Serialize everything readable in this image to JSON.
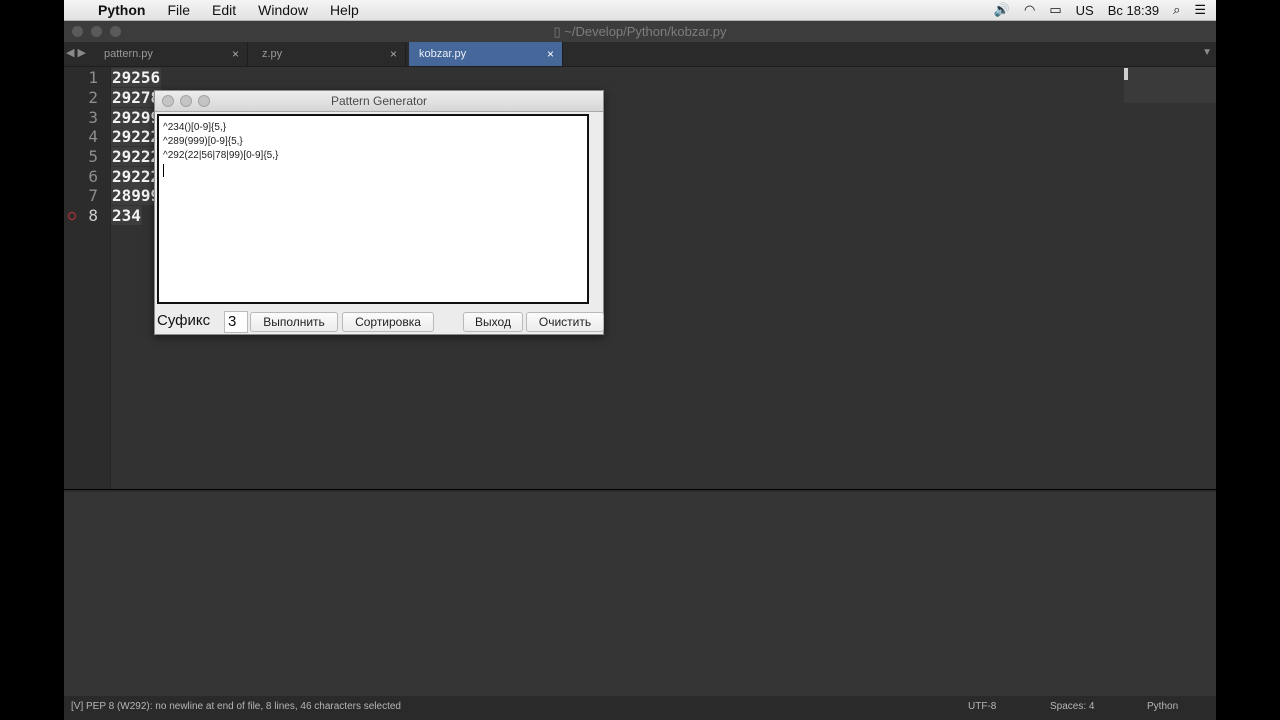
{
  "menubar": {
    "app": "Python",
    "items": [
      "File",
      "Edit",
      "Window",
      "Help"
    ],
    "right": {
      "lang": "US",
      "time": "Вс 18:39"
    }
  },
  "window": {
    "title": "~/Develop/Python/kobzar.py"
  },
  "tabs": [
    {
      "label": "pattern.py",
      "active": false
    },
    {
      "label": "z.py",
      "active": false
    },
    {
      "label": "kobzar.py",
      "active": true
    }
  ],
  "editor": {
    "lines": [
      "29256",
      "29278",
      "29299",
      "29222",
      "29222",
      "29222",
      "28999",
      "234"
    ],
    "line_numbers": [
      "1",
      "2",
      "3",
      "4",
      "5",
      "6",
      "7",
      "8"
    ]
  },
  "status": {
    "message": "[V] PEP 8 (W292): no newline at end of file, 8 lines, 46 characters selected",
    "encoding": "UTF-8",
    "spaces": "Spaces: 4",
    "syntax": "Python"
  },
  "dialog": {
    "title": "Pattern Generator",
    "text_lines": [
      "^234()[0-9]{5,}",
      "^289(999)[0-9]{5,}",
      "^292(22|56|78|99)[0-9]{5,}"
    ],
    "suffix_label": "Суфикс",
    "suffix_value": "3",
    "buttons": {
      "run": "Выполнить",
      "sort": "Сортировка",
      "exit": "Выход",
      "clear": "Очистить"
    }
  }
}
